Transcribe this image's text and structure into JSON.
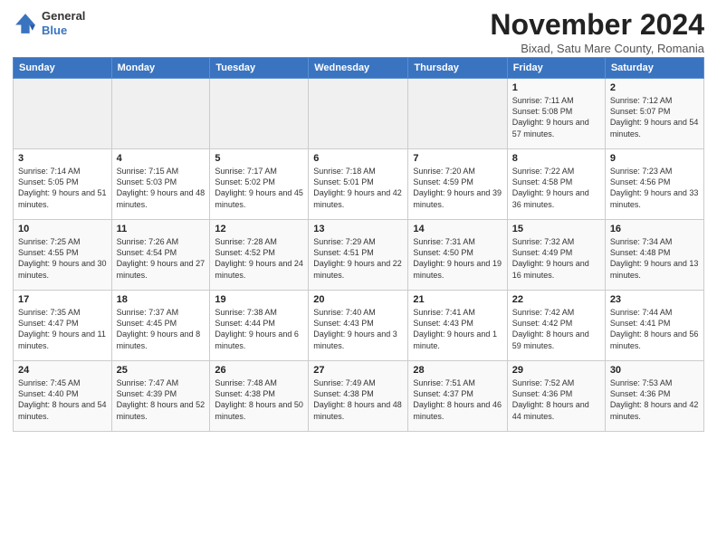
{
  "logo": {
    "line1": "General",
    "line2": "Blue"
  },
  "title": "November 2024",
  "subtitle": "Bixad, Satu Mare County, Romania",
  "days_header": [
    "Sunday",
    "Monday",
    "Tuesday",
    "Wednesday",
    "Thursday",
    "Friday",
    "Saturday"
  ],
  "weeks": [
    [
      {
        "day": "",
        "info": ""
      },
      {
        "day": "",
        "info": ""
      },
      {
        "day": "",
        "info": ""
      },
      {
        "day": "",
        "info": ""
      },
      {
        "day": "",
        "info": ""
      },
      {
        "day": "1",
        "info": "Sunrise: 7:11 AM\nSunset: 5:08 PM\nDaylight: 9 hours and 57 minutes."
      },
      {
        "day": "2",
        "info": "Sunrise: 7:12 AM\nSunset: 5:07 PM\nDaylight: 9 hours and 54 minutes."
      }
    ],
    [
      {
        "day": "3",
        "info": "Sunrise: 7:14 AM\nSunset: 5:05 PM\nDaylight: 9 hours and 51 minutes."
      },
      {
        "day": "4",
        "info": "Sunrise: 7:15 AM\nSunset: 5:03 PM\nDaylight: 9 hours and 48 minutes."
      },
      {
        "day": "5",
        "info": "Sunrise: 7:17 AM\nSunset: 5:02 PM\nDaylight: 9 hours and 45 minutes."
      },
      {
        "day": "6",
        "info": "Sunrise: 7:18 AM\nSunset: 5:01 PM\nDaylight: 9 hours and 42 minutes."
      },
      {
        "day": "7",
        "info": "Sunrise: 7:20 AM\nSunset: 4:59 PM\nDaylight: 9 hours and 39 minutes."
      },
      {
        "day": "8",
        "info": "Sunrise: 7:22 AM\nSunset: 4:58 PM\nDaylight: 9 hours and 36 minutes."
      },
      {
        "day": "9",
        "info": "Sunrise: 7:23 AM\nSunset: 4:56 PM\nDaylight: 9 hours and 33 minutes."
      }
    ],
    [
      {
        "day": "10",
        "info": "Sunrise: 7:25 AM\nSunset: 4:55 PM\nDaylight: 9 hours and 30 minutes."
      },
      {
        "day": "11",
        "info": "Sunrise: 7:26 AM\nSunset: 4:54 PM\nDaylight: 9 hours and 27 minutes."
      },
      {
        "day": "12",
        "info": "Sunrise: 7:28 AM\nSunset: 4:52 PM\nDaylight: 9 hours and 24 minutes."
      },
      {
        "day": "13",
        "info": "Sunrise: 7:29 AM\nSunset: 4:51 PM\nDaylight: 9 hours and 22 minutes."
      },
      {
        "day": "14",
        "info": "Sunrise: 7:31 AM\nSunset: 4:50 PM\nDaylight: 9 hours and 19 minutes."
      },
      {
        "day": "15",
        "info": "Sunrise: 7:32 AM\nSunset: 4:49 PM\nDaylight: 9 hours and 16 minutes."
      },
      {
        "day": "16",
        "info": "Sunrise: 7:34 AM\nSunset: 4:48 PM\nDaylight: 9 hours and 13 minutes."
      }
    ],
    [
      {
        "day": "17",
        "info": "Sunrise: 7:35 AM\nSunset: 4:47 PM\nDaylight: 9 hours and 11 minutes."
      },
      {
        "day": "18",
        "info": "Sunrise: 7:37 AM\nSunset: 4:45 PM\nDaylight: 9 hours and 8 minutes."
      },
      {
        "day": "19",
        "info": "Sunrise: 7:38 AM\nSunset: 4:44 PM\nDaylight: 9 hours and 6 minutes."
      },
      {
        "day": "20",
        "info": "Sunrise: 7:40 AM\nSunset: 4:43 PM\nDaylight: 9 hours and 3 minutes."
      },
      {
        "day": "21",
        "info": "Sunrise: 7:41 AM\nSunset: 4:43 PM\nDaylight: 9 hours and 1 minute."
      },
      {
        "day": "22",
        "info": "Sunrise: 7:42 AM\nSunset: 4:42 PM\nDaylight: 8 hours and 59 minutes."
      },
      {
        "day": "23",
        "info": "Sunrise: 7:44 AM\nSunset: 4:41 PM\nDaylight: 8 hours and 56 minutes."
      }
    ],
    [
      {
        "day": "24",
        "info": "Sunrise: 7:45 AM\nSunset: 4:40 PM\nDaylight: 8 hours and 54 minutes."
      },
      {
        "day": "25",
        "info": "Sunrise: 7:47 AM\nSunset: 4:39 PM\nDaylight: 8 hours and 52 minutes."
      },
      {
        "day": "26",
        "info": "Sunrise: 7:48 AM\nSunset: 4:38 PM\nDaylight: 8 hours and 50 minutes."
      },
      {
        "day": "27",
        "info": "Sunrise: 7:49 AM\nSunset: 4:38 PM\nDaylight: 8 hours and 48 minutes."
      },
      {
        "day": "28",
        "info": "Sunrise: 7:51 AM\nSunset: 4:37 PM\nDaylight: 8 hours and 46 minutes."
      },
      {
        "day": "29",
        "info": "Sunrise: 7:52 AM\nSunset: 4:36 PM\nDaylight: 8 hours and 44 minutes."
      },
      {
        "day": "30",
        "info": "Sunrise: 7:53 AM\nSunset: 4:36 PM\nDaylight: 8 hours and 42 minutes."
      }
    ]
  ]
}
